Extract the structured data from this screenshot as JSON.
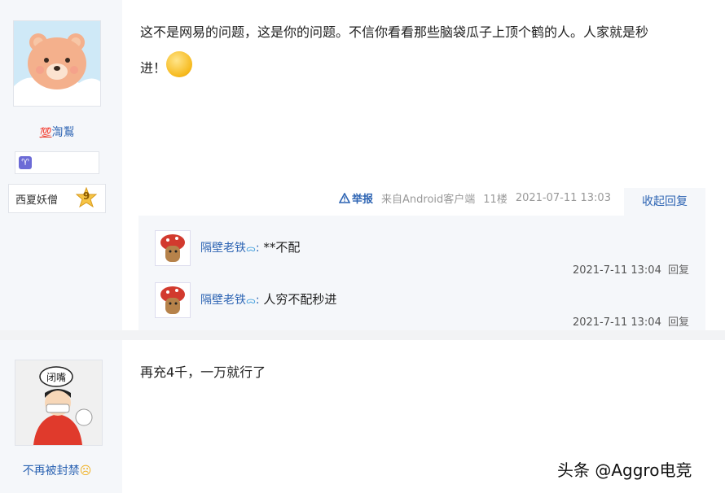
{
  "post1": {
    "username": "渹鵥",
    "username_prefix_icon": "hundred-icon",
    "zodiac_icon": "aries-icon",
    "title_label": "西夏妖僧",
    "level": "9",
    "content_line1": "这不是网易的问题，这是你的问题。不信你看看那些脑袋瓜子上顶个鹤的人。人家就是秒",
    "content_line2": "进！",
    "report_label": "举报",
    "source": "来自Android客户端",
    "floor": "11楼",
    "timestamp": "2021-07-11 13:03",
    "collapse_label": "收起回复",
    "replies": [
      {
        "name": "隔壁老铁",
        "sep": ":",
        "text": "**不配",
        "time": "2021-7-11 13:04",
        "reply_label": "回复"
      },
      {
        "name": "隔壁老铁",
        "sep": ":",
        "text": "人穷不配秒进",
        "time": "2021-7-11 13:04",
        "reply_label": "回复"
      }
    ]
  },
  "post2": {
    "avatar_bubble": "闭嘴",
    "username": "不再被封禁",
    "content": "再充4千，一万就行了"
  },
  "watermark": "头条 @Aggro电竞",
  "colors": {
    "link": "#2d64b3",
    "sidebar_bg": "#f5f7fa",
    "zodiac": "#6c6bd6"
  }
}
